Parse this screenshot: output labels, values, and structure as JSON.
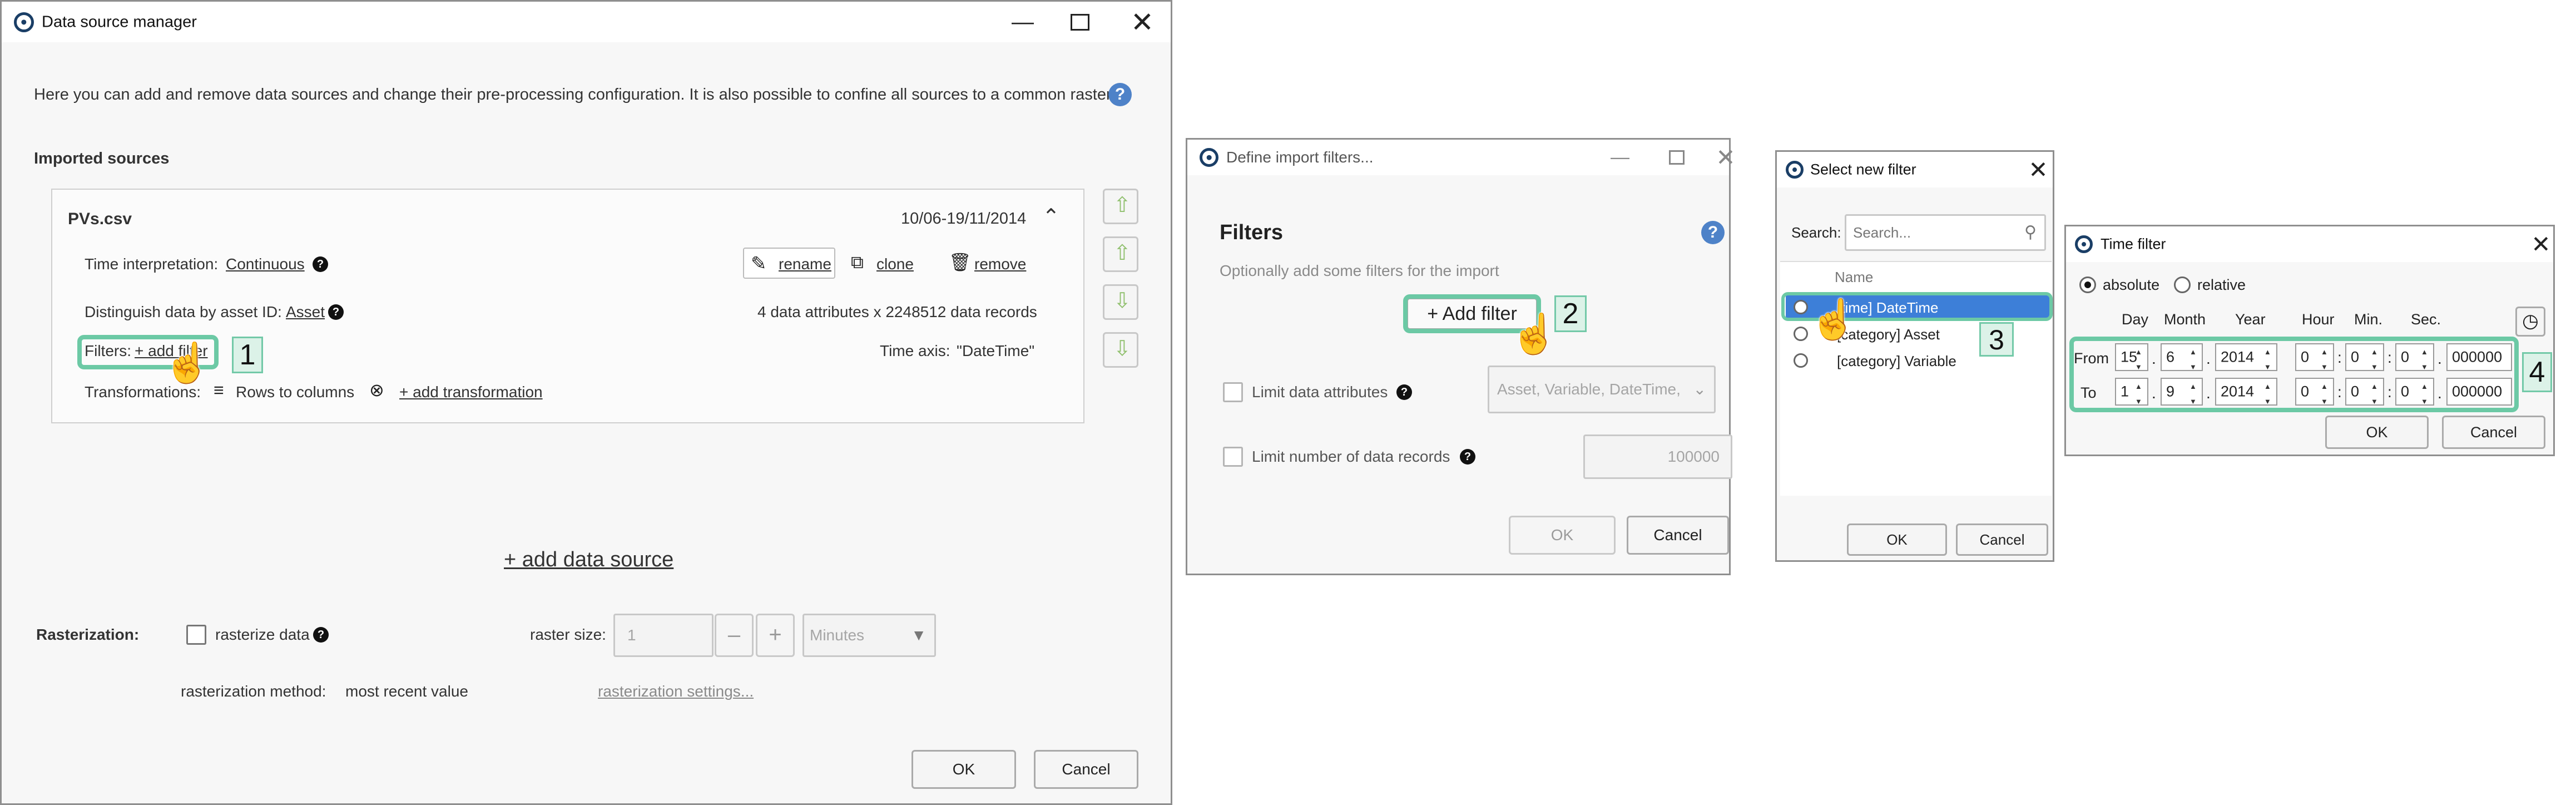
{
  "dsm": {
    "title": "Data source manager",
    "intro": "Here you can add and remove data sources and change their pre-processing configuration. It is also possible to confine all sources to a common raster.",
    "imported_heading": "Imported sources",
    "source": {
      "name": "PVs.csv",
      "date_range": "10/06-19/11/2014",
      "time_interp_label": "Time interpretation:",
      "time_interp_value": "Continuous",
      "rename": "rename",
      "clone": "clone",
      "remove": "remove",
      "distinguish_label": "Distinguish data by asset ID:",
      "distinguish_value": "Asset",
      "attributes_info": "4 data attributes x 2248512 data records",
      "filters_label": "Filters:",
      "add_filter": "+ add filter",
      "time_axis_label": "Time axis:",
      "time_axis_value": "\"DateTime\"",
      "transformations_label": "Transformations:",
      "rows_to_columns": "Rows to columns",
      "add_transformation": "+ add transformation"
    },
    "add_data_source": "+ add data source",
    "rasterization": {
      "label": "Rasterization:",
      "rasterize_label": "rasterize data",
      "raster_size_label": "raster size:",
      "raster_size_value": "1",
      "unit": "Minutes",
      "method_label": "rasterization method:",
      "method_value": "most recent value",
      "settings_link": "rasterization settings..."
    },
    "ok": "OK",
    "cancel": "Cancel"
  },
  "import_filters": {
    "title": "Define import filters...",
    "heading": "Filters",
    "subtitle": "Optionally add some filters for the import",
    "add_filter": "+ Add filter",
    "limit_attributes_label": "Limit data attributes",
    "limit_attributes_placeholder": "Asset, Variable, DateTime,",
    "limit_records_label": "Limit number of data records",
    "limit_records_placeholder": "100000",
    "ok": "OK",
    "cancel": "Cancel"
  },
  "select_filter": {
    "title": "Select new filter",
    "search_label": "Search:",
    "search_placeholder": "Search...",
    "column_name": "Name",
    "items": [
      {
        "label": "[time] DateTime"
      },
      {
        "label": "[category] Asset"
      },
      {
        "label": "[category] Variable"
      }
    ],
    "ok": "OK",
    "cancel": "Cancel"
  },
  "time_filter": {
    "title": "Time filter",
    "absolute": "absolute",
    "relative": "relative",
    "headers": {
      "day": "Day",
      "month": "Month",
      "year": "Year",
      "hour": "Hour",
      "min": "Min.",
      "sec": "Sec."
    },
    "from_label": "From",
    "to_label": "To",
    "from": {
      "day": "15",
      "month": "6",
      "year": "2014",
      "hour": "0",
      "min": "0",
      "sec": "0",
      "ms": "000000"
    },
    "to": {
      "day": "1",
      "month": "9",
      "year": "2014",
      "hour": "0",
      "min": "0",
      "sec": "0",
      "ms": "000000"
    },
    "ok": "OK",
    "cancel": "Cancel"
  },
  "steps": [
    "1",
    "2",
    "3",
    "4"
  ],
  "colors": {
    "highlight": "#6cc9a5",
    "step_fill": "#dcf2e8",
    "selection": "#3d7fd8",
    "help": "#4e82c8",
    "app_icon": "#1a3e66"
  }
}
